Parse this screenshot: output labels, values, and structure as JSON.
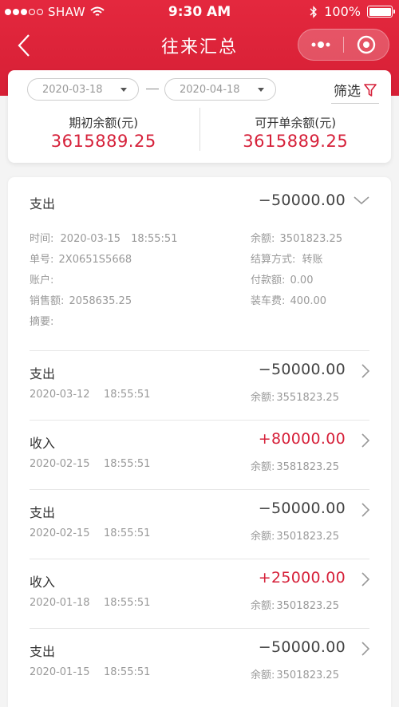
{
  "status_bar": {
    "carrier": "SHAW",
    "time": "9:30 AM",
    "battery_text": "100%",
    "battery_level": 1.0,
    "signal_dots": [
      true,
      true,
      true,
      false,
      false
    ]
  },
  "nav": {
    "title": "往来汇总",
    "back_icon": "chevron-left-icon",
    "more_icon": "more-dots-icon",
    "close_icon": "target-circle-icon"
  },
  "filter": {
    "start_date": "2020-03-18",
    "end_date": "2020-04-18",
    "filter_label": "筛选",
    "filter_icon": "funnel-icon",
    "accent_color": "#d6213a"
  },
  "summary": {
    "opening_label": "期初余额(元)",
    "opening_value": "3615889.25",
    "available_label": "可开单余额(元)",
    "available_value": "3615889.25"
  },
  "expanded": {
    "type": "支出",
    "amount": "−50000.00",
    "time_label": "时间:",
    "time_value": "2020-03-15　18:55:51",
    "order_label": "单号:",
    "order_value": "2X0651S5668",
    "account_label": "账户:",
    "account_value": "",
    "sales_label": "销售额:",
    "sales_value": "2058635.25",
    "memo_label": "摘要:",
    "memo_value": "",
    "balance_label": "余额:",
    "balance_value": "3501823.25",
    "settle_label": "结算方式:",
    "settle_value": "转账",
    "paid_label": "付款额:",
    "paid_value": "0.00",
    "loading_label": "装车费:",
    "loading_value": "400.00"
  },
  "transactions": [
    {
      "type": "支出",
      "amount": "−50000.00",
      "income": false,
      "date": "2020-03-12",
      "time": "18:55:51",
      "balance_label": "余额:",
      "balance": "3551823.25"
    },
    {
      "type": "收入",
      "amount": "+80000.00",
      "income": true,
      "date": "2020-02-15",
      "time": "18:55:51",
      "balance_label": "余额:",
      "balance": "3581823.25"
    },
    {
      "type": "支出",
      "amount": "−50000.00",
      "income": false,
      "date": "2020-02-15",
      "time": "18:55:51",
      "balance_label": "余额:",
      "balance": "3501823.25"
    },
    {
      "type": "收入",
      "amount": "+25000.00",
      "income": true,
      "date": "2020-01-18",
      "time": "18:55:51",
      "balance_label": "余额:",
      "balance": "3501823.25"
    },
    {
      "type": "支出",
      "amount": "−50000.00",
      "income": false,
      "date": "2020-01-15",
      "time": "18:55:51",
      "balance_label": "余额:",
      "balance": "3501823.25"
    }
  ]
}
